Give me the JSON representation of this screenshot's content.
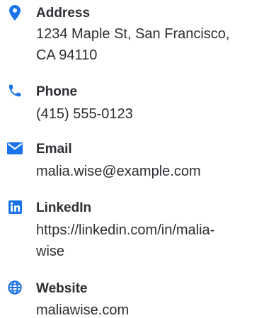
{
  "accent_color": "#1a73e8",
  "contacts": [
    {
      "icon": "map-pin-icon",
      "label": "Address",
      "value": "1234 Maple St, San Francisco,\nCA 94110"
    },
    {
      "icon": "phone-icon",
      "label": "Phone",
      "value": "(415) 555-0123"
    },
    {
      "icon": "envelope-icon",
      "label": "Email",
      "value": "malia.wise@example.com"
    },
    {
      "icon": "linkedin-icon",
      "label": "LinkedIn",
      "value": "https://linkedin.com/in/malia-\nwise"
    },
    {
      "icon": "globe-icon",
      "label": "Website",
      "value": "maliawise.com"
    }
  ]
}
